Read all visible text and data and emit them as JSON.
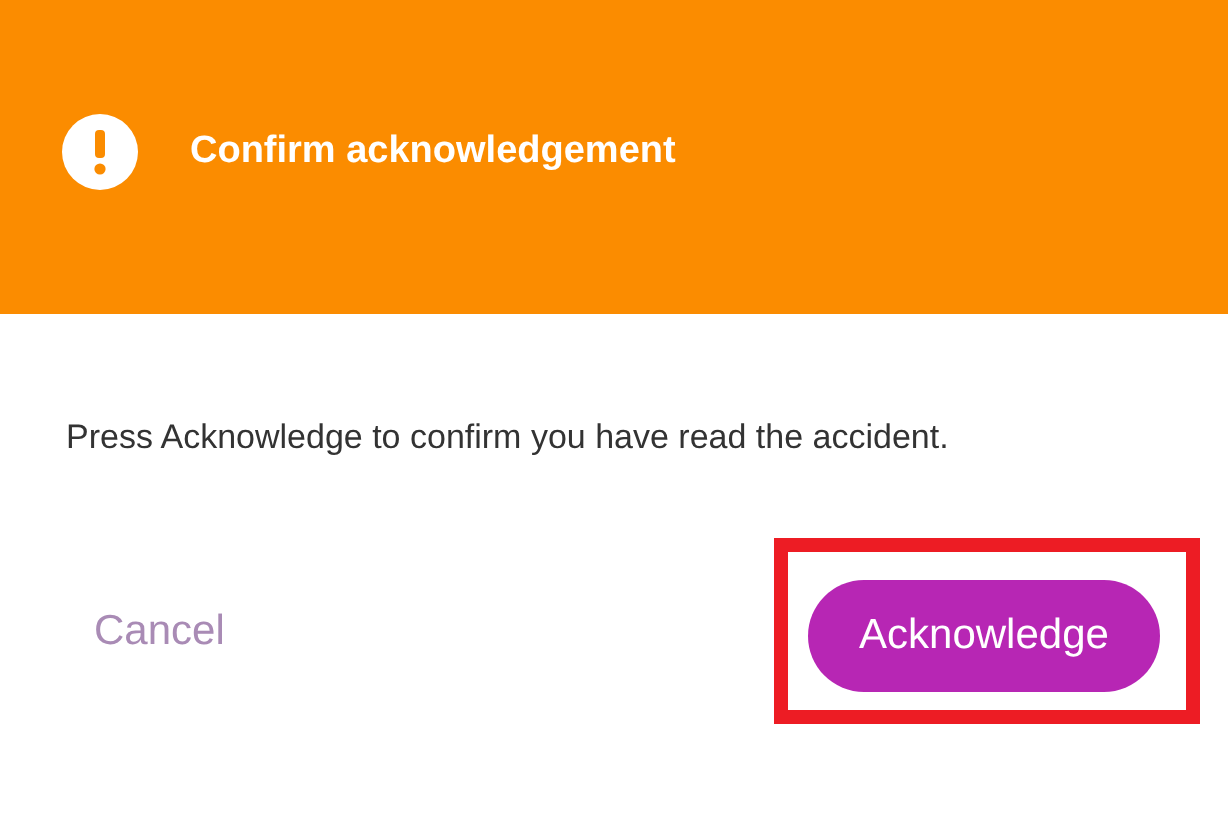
{
  "dialog": {
    "title": "Confirm acknowledgement",
    "message": "Press Acknowledge to confirm you have read the accident.",
    "buttons": [
      {
        "label": "Cancel",
        "kind": "text",
        "highlighted": false
      },
      {
        "label": "Acknowledge",
        "kind": "filled",
        "highlighted": true
      }
    ]
  }
}
